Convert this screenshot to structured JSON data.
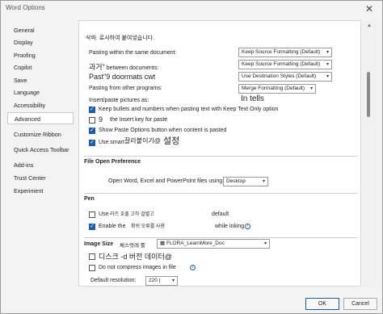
{
  "window": {
    "title": "Word Options",
    "close": "✕"
  },
  "sidebar": {
    "items": [
      {
        "label": "General"
      },
      {
        "label": "Display"
      },
      {
        "label": "Proofing"
      },
      {
        "label": "Copilot"
      },
      {
        "label": "Save"
      },
      {
        "label": "Language"
      },
      {
        "label": "Accessibility"
      },
      {
        "label": "Advanced",
        "active": true
      },
      {
        "label": "Customize Ribbon"
      },
      {
        "label": "Quick Access Toolbar"
      },
      {
        "label": "Add-ins"
      },
      {
        "label": "Trust Center"
      },
      {
        "label": "Experiment"
      }
    ]
  },
  "content": {
    "top_heading": "삭파.   로사하여   붙여넣습니다.",
    "paste_same_doc": {
      "label": "Pasting within the same document:",
      "value": "Keep Source Formatting (Default)"
    },
    "paste_between": {
      "label_prefix": "과거\"",
      "label_rest": " between documents:",
      "value": "Keep Source Formatting (Default)"
    },
    "paste_conflict": {
      "label": "Past\"9 doormats cwt",
      "value": "Use Destination Styles (Default)"
    },
    "paste_other": {
      "label": "Pasting from other programs:",
      "value": "Merge Formatting (Default)"
    },
    "insert_pictures": {
      "label": "Insert/paste pictures as:",
      "value": "In tells"
    },
    "keep_bullets": {
      "label": "Keep bullets and numbers when pasting text with Keep Text Only option",
      "checked": true
    },
    "insert_key": {
      "prefix": "9",
      "label": "the Insert key for paste",
      "checked": false
    },
    "show_paste_options": {
      "label": "Show Paste Options button when content is pasted",
      "checked": true
    },
    "use_smart": {
      "label": "Use smart",
      "extra": "잘라붙이기@",
      "extra_big": "설정",
      "checked": true
    },
    "file_open": {
      "heading": "File Open Preference",
      "label": "Open Word, Excel and PowerPoint files using:",
      "value": "Desktop"
    },
    "pen": {
      "heading": "Pen",
      "use_pen": {
        "label": "Use",
        "label_ko": "라즈 호출 고하 걸렬고",
        "suffix": "default",
        "checked": false
      },
      "enable_pen": {
        "label": "Enable the",
        "label_ko": "확쉬 오류를 사용",
        "suffix": "while inking",
        "checked": true
      }
    },
    "image_size": {
      "heading": "Image Size",
      "heading_ko": "체스멋레 룰",
      "doc_value": "FLORA_LearnMore_Doc",
      "discard_edit": {
        "label": "디스크 -d 버전 데이터@",
        "checked": false
      },
      "no_compress": {
        "label": "Do not compress images in file",
        "checked": false
      },
      "resolution": {
        "label": "Default resolution:",
        "value": "220 |"
      }
    }
  },
  "footer": {
    "ok": "OK",
    "cancel": "Cancel"
  },
  "icons": {
    "dropdown": "chevron-down-icon",
    "info": "info-icon",
    "document": "document-icon"
  }
}
